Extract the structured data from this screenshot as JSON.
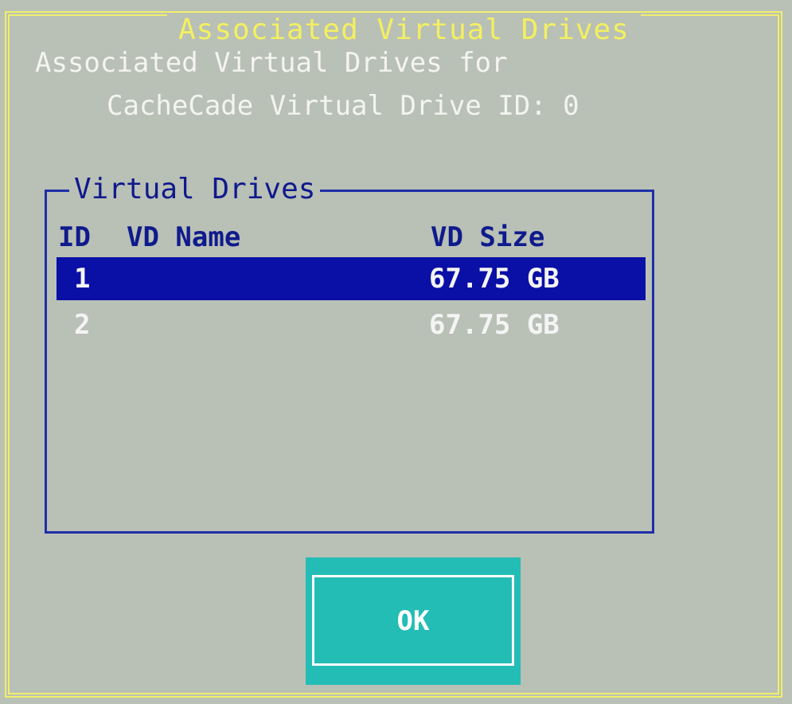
{
  "dialog": {
    "title": "Associated Virtual Drives",
    "description_line1": "Associated Virtual Drives for",
    "description_line2": "CacheCade Virtual Drive ID: 0"
  },
  "virtual_drives": {
    "group_label": "Virtual Drives",
    "columns": {
      "id": "ID",
      "name": "VD Name",
      "size": "VD Size"
    },
    "rows": [
      {
        "id": "1",
        "name": "",
        "size": "67.75 GB",
        "selected": true
      },
      {
        "id": "2",
        "name": "",
        "size": "67.75 GB",
        "selected": false
      }
    ]
  },
  "ok_button": {
    "label": "OK"
  },
  "colors": {
    "background": "#b9c0b6",
    "frame": "#f0ef6a",
    "title": "#f3f060",
    "group_border": "#1f2fa8",
    "selection": "#0a0fa6",
    "button": "#23bdb5"
  }
}
